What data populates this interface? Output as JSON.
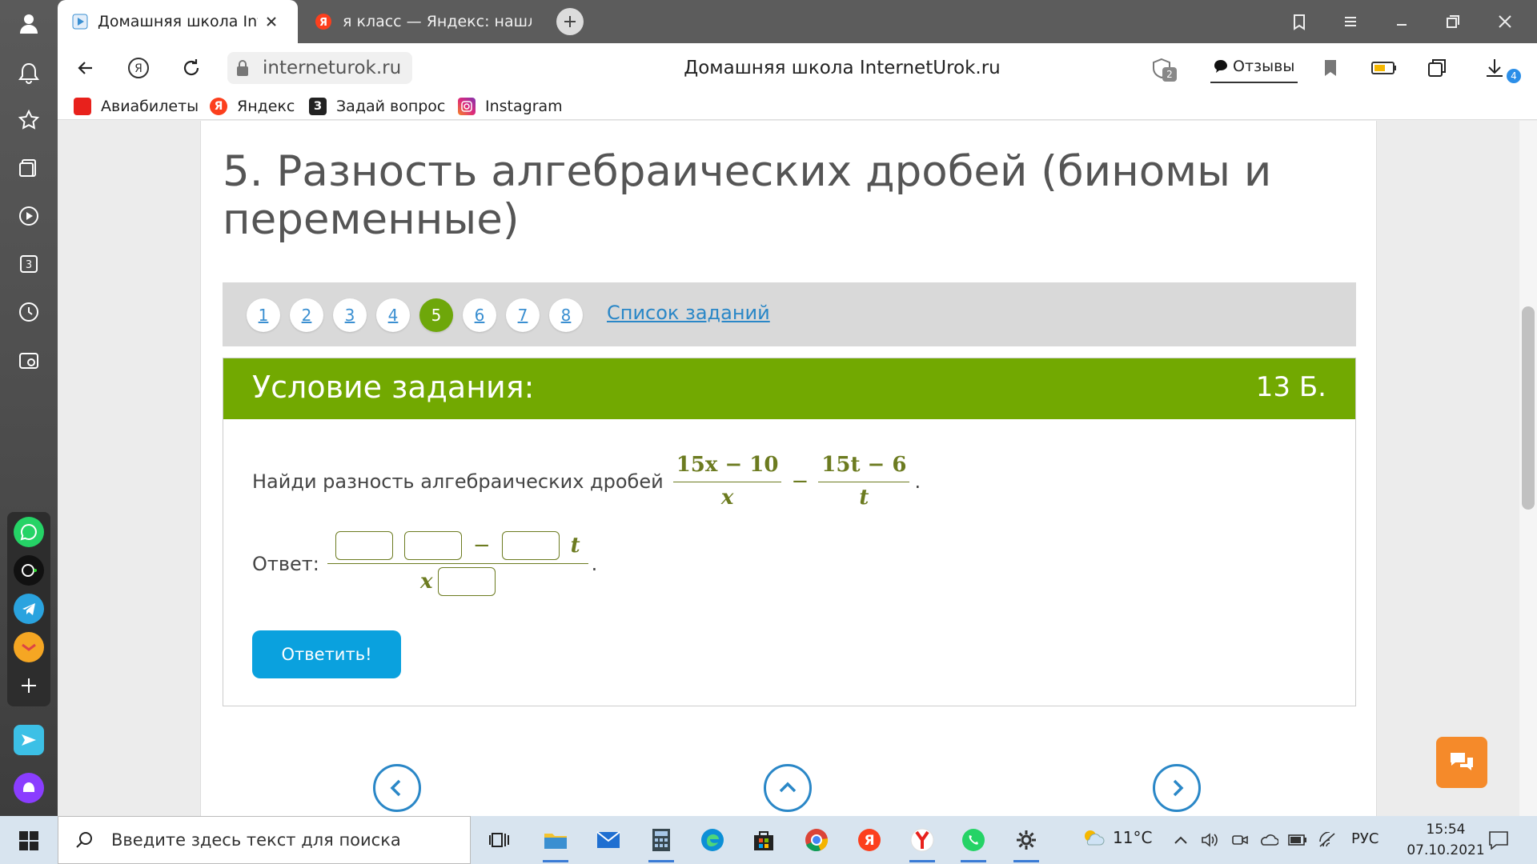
{
  "browser": {
    "tabs": [
      {
        "title": "Домашняя школа InternetUrok.ru"
      },
      {
        "title": "я класс — Яндекс: нашлось"
      }
    ],
    "url": "interneturok.ru",
    "page_title": "Домашняя школа InternetUrok.ru",
    "reviews_label": "Отзывы",
    "extension_badge": "2",
    "downloads_badge": "4",
    "bookmarks": [
      {
        "label": "Авиабилеты",
        "color": "#e8211c"
      },
      {
        "label": "Яндекс",
        "color": "#fc3f1d"
      },
      {
        "label": "Задай вопрос",
        "color": "#222222",
        "glyph": "З"
      },
      {
        "label": "Instagram",
        "color": "#d6249f"
      }
    ]
  },
  "lesson": {
    "heading": "5. Разность алгебраических дробей (биномы и переменные)",
    "pages": [
      "1",
      "2",
      "3",
      "4",
      "5",
      "6",
      "7",
      "8"
    ],
    "active_page": "5",
    "task_list_link": "Список заданий",
    "task": {
      "title": "Условие задания:",
      "points": "13 Б.",
      "question_text": "Найди разность алгебраических дробей",
      "fraction1": {
        "num": "15x − 10",
        "den": "x"
      },
      "minus": "−",
      "fraction2": {
        "num": "15t − 6",
        "den": "t"
      },
      "period": ".",
      "answer_label": "Ответ:",
      "answer_minus": "−",
      "answer_var_t": "t",
      "answer_var_x": "x",
      "submit_label": "Ответить!"
    }
  },
  "taskbar": {
    "search_placeholder": "Введите здесь текст для поиска",
    "temperature": "11°C",
    "language": "РУС",
    "time": "15:54",
    "date": "07.10.2021"
  },
  "colors": {
    "accent_green": "#72a901",
    "link_blue": "#2a87c7",
    "button_blue": "#0aa1de",
    "chat_orange": "#f58a2a"
  }
}
